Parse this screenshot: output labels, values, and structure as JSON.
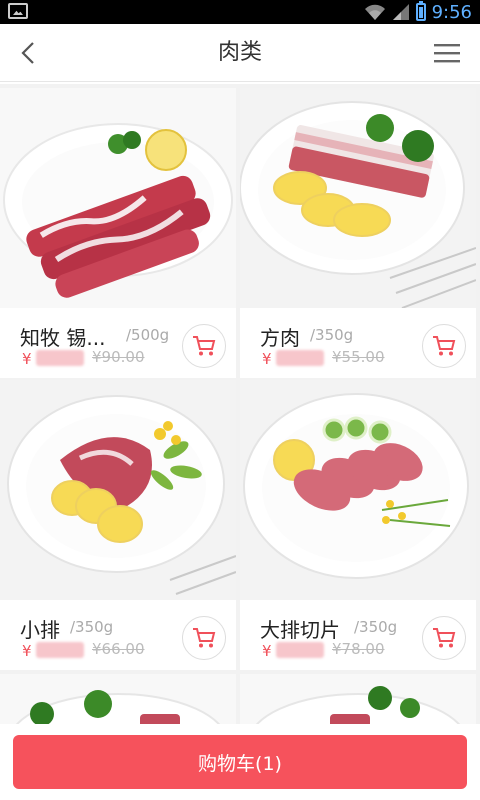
{
  "status_bar": {
    "time": "9:56"
  },
  "header": {
    "title": "肉类",
    "back_icon": "chevron-left-icon",
    "menu_icon": "hamburger-menu-icon"
  },
  "products": [
    {
      "name": "知牧 锡...",
      "weight": "/500g",
      "currency": "¥",
      "original_price": "¥90.00"
    },
    {
      "name": "方肉",
      "weight": "/350g",
      "currency": "¥",
      "original_price": "¥55.00"
    },
    {
      "name": "小排",
      "weight": "/350g",
      "currency": "¥",
      "original_price": "¥66.00"
    },
    {
      "name": "大排切片",
      "weight": "/350g",
      "currency": "¥",
      "original_price": "¥78.00"
    }
  ],
  "footer": {
    "cart_label": "购物车(1)"
  },
  "colors": {
    "accent": "#f6525c",
    "price": "#f0505a"
  }
}
